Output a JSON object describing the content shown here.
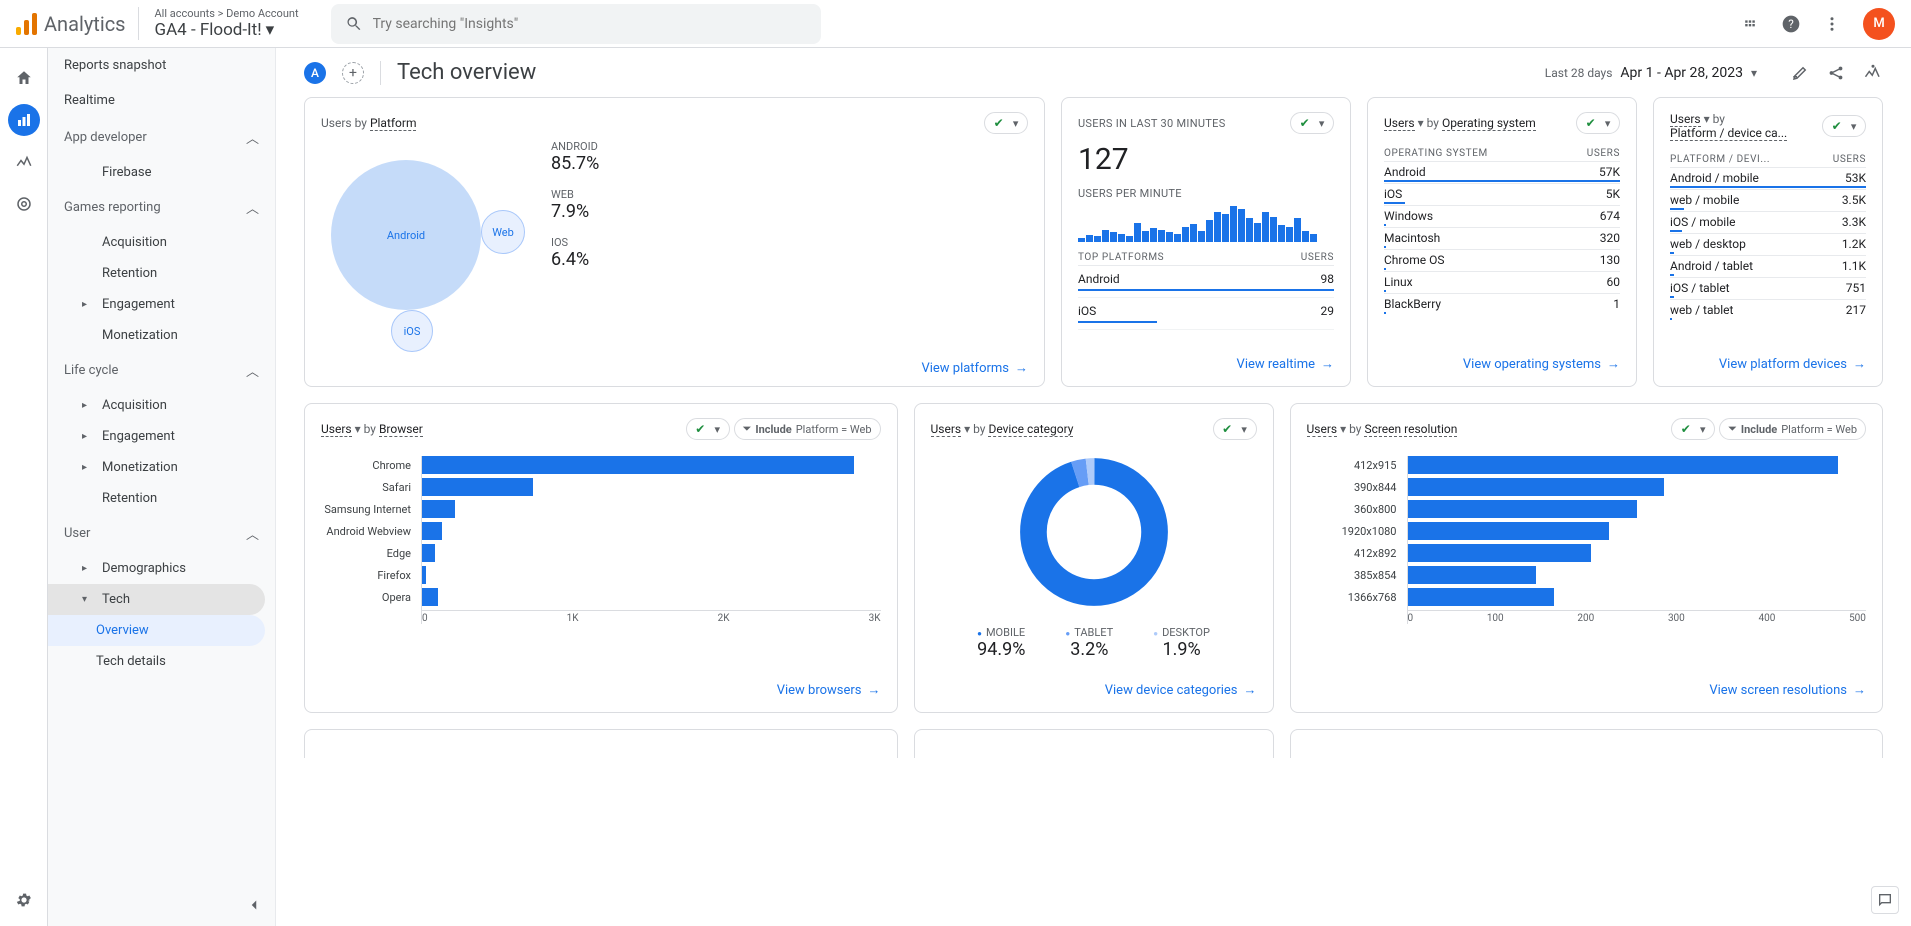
{
  "header": {
    "product": "Analytics",
    "breadcrumb": "All accounts > Demo Account",
    "property": "GA4 - Flood-It!",
    "search_placeholder": "Try searching \"Insights\"",
    "avatar_initial": "M"
  },
  "nav": {
    "snapshot": "Reports snapshot",
    "realtime": "Realtime",
    "app_dev": "App developer",
    "firebase": "Firebase",
    "games": "Games reporting",
    "acquisition": "Acquisition",
    "retention": "Retention",
    "engagement": "Engagement",
    "monetization": "Monetization",
    "life_cycle": "Life cycle",
    "user": "User",
    "demographics": "Demographics",
    "tech": "Tech",
    "overview": "Overview",
    "tech_details": "Tech details"
  },
  "title": {
    "page": "Tech overview",
    "chip": "A",
    "last_label": "Last 28 days",
    "date_range": "Apr 1 - Apr 28, 2023"
  },
  "card_platform": {
    "title_metric": "Users",
    "title_by": "by",
    "title_dim": "Platform",
    "android_lbl": "Android",
    "web_lbl": "Web",
    "ios_lbl": "iOS",
    "android_hdr": "ANDROID",
    "android_val": "85.7%",
    "web_hdr": "WEB",
    "web_val": "7.9%",
    "ios_hdr": "IOS",
    "ios_val": "6.4%",
    "footer": "View platforms"
  },
  "card_realtime": {
    "hdr": "USERS IN LAST 30 MINUTES",
    "value": "127",
    "upm": "USERS PER MINUTE",
    "top_plat": "TOP PLATFORMS",
    "users": "USERS",
    "rows": [
      {
        "name": "Android",
        "val": "98",
        "w": 100
      },
      {
        "name": "iOS",
        "val": "29",
        "w": 31
      }
    ],
    "footer": "View realtime"
  },
  "card_os": {
    "metric": "Users",
    "by": "by",
    "dim": "Operating system",
    "col1": "OPERATING SYSTEM",
    "col2": "USERS",
    "rows": [
      {
        "name": "Android",
        "val": "57K",
        "w": 100
      },
      {
        "name": "iOS",
        "val": "5K",
        "w": 9
      },
      {
        "name": "Windows",
        "val": "674",
        "w": 1
      },
      {
        "name": "Macintosh",
        "val": "320",
        "w": 1
      },
      {
        "name": "Chrome OS",
        "val": "130",
        "w": 1
      },
      {
        "name": "Linux",
        "val": "60",
        "w": 1
      },
      {
        "name": "BlackBerry",
        "val": "1",
        "w": 1
      }
    ],
    "footer": "View operating systems"
  },
  "card_pd": {
    "metric": "Users",
    "by": "by",
    "dim": "Platform / device ca...",
    "col1": "PLATFORM / DEVI...",
    "col2": "USERS",
    "rows": [
      {
        "name": "Android / mobile",
        "val": "53K",
        "w": 100
      },
      {
        "name": "web / mobile",
        "val": "3.5K",
        "w": 7
      },
      {
        "name": "iOS / mobile",
        "val": "3.3K",
        "w": 6
      },
      {
        "name": "web / desktop",
        "val": "1.2K",
        "w": 2
      },
      {
        "name": "Android / tablet",
        "val": "1.1K",
        "w": 2
      },
      {
        "name": "iOS / tablet",
        "val": "751",
        "w": 2
      },
      {
        "name": "web / tablet",
        "val": "217",
        "w": 1
      }
    ],
    "footer": "View platform devices"
  },
  "card_browser": {
    "metric": "Users",
    "by": "by",
    "dim": "Browser",
    "include": "Include",
    "include_val": "Platform = Web",
    "footer": "View browsers"
  },
  "card_device": {
    "metric": "Users",
    "by": "by",
    "dim": "Device category",
    "mobile_lbl": "MOBILE",
    "mobile_val": "94.9%",
    "tablet_lbl": "TABLET",
    "tablet_val": "3.2%",
    "desktop_lbl": "DESKTOP",
    "desktop_val": "1.9%",
    "footer": "View device categories"
  },
  "card_screen": {
    "metric": "Users",
    "by": "by",
    "dim": "Screen resolution",
    "include": "Include",
    "include_val": "Platform = Web",
    "footer": "View screen resolutions"
  },
  "chart_data": {
    "platform_bubble": {
      "type": "bubble",
      "title": "Users by Platform",
      "series": [
        {
          "name": "Android",
          "value": 85.7
        },
        {
          "name": "Web",
          "value": 7.9
        },
        {
          "name": "iOS",
          "value": 6.4
        }
      ]
    },
    "realtime_spark": {
      "type": "bar",
      "title": "Users per minute",
      "values": [
        3,
        5,
        4,
        9,
        7,
        6,
        4,
        14,
        8,
        10,
        9,
        7,
        6,
        11,
        13,
        8,
        16,
        22,
        20,
        26,
        24,
        17,
        14,
        22,
        18,
        12,
        11,
        17,
        8,
        6
      ]
    },
    "browser_bar": {
      "type": "bar",
      "orientation": "horizontal",
      "title": "Users by Browser",
      "xlim": [
        0,
        3500
      ],
      "xticks": [
        0,
        1000,
        2000,
        3000
      ],
      "xticklabels": [
        "0",
        "1K",
        "2K",
        "3K"
      ],
      "categories": [
        "Chrome",
        "Safari",
        "Samsung Internet",
        "Android Webview",
        "Edge",
        "Firefox",
        "Opera"
      ],
      "values": [
        3300,
        850,
        250,
        150,
        100,
        30,
        120
      ]
    },
    "device_donut": {
      "type": "pie",
      "title": "Users by Device category",
      "series": [
        {
          "name": "mobile",
          "value": 94.9
        },
        {
          "name": "tablet",
          "value": 3.2
        },
        {
          "name": "desktop",
          "value": 1.9
        }
      ]
    },
    "screen_bar": {
      "type": "bar",
      "orientation": "horizontal",
      "title": "Users by Screen resolution",
      "xlim": [
        0,
        500
      ],
      "xticks": [
        0,
        100,
        200,
        300,
        400,
        500
      ],
      "categories": [
        "412x915",
        "390x844",
        "360x800",
        "1920x1080",
        "412x892",
        "385x854",
        "1366x768"
      ],
      "values": [
        470,
        280,
        250,
        220,
        200,
        140,
        160
      ]
    }
  }
}
